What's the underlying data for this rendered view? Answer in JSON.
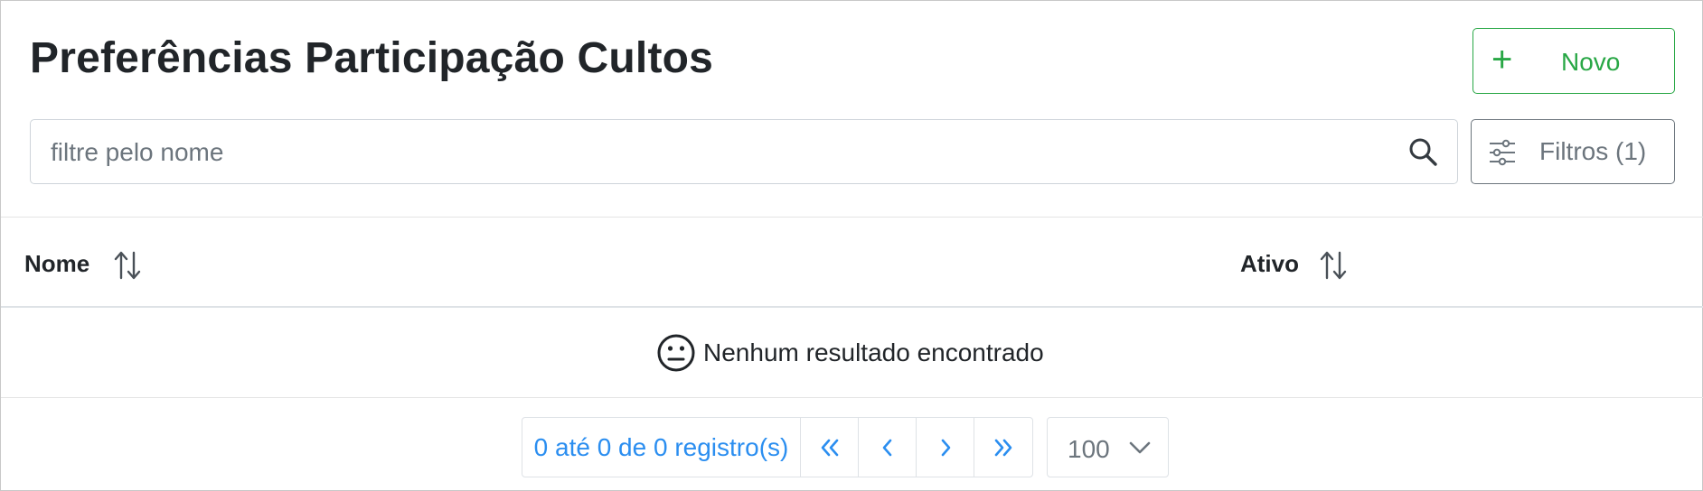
{
  "header": {
    "title": "Preferências Participação Cultos",
    "new_button": {
      "icon": "plus-icon",
      "label": "Novo"
    }
  },
  "search": {
    "placeholder": "filtre pelo nome",
    "value": "",
    "icon": "search-icon"
  },
  "filters_button": {
    "icon": "sliders-icon",
    "label": "Filtros (1)"
  },
  "table": {
    "columns": [
      {
        "label": "Nome",
        "sort_icon": "sort-up-down-icon"
      },
      {
        "label": "Ativo",
        "sort_icon": "sort-up-down-icon"
      }
    ],
    "rows": [],
    "empty_state": {
      "icon": "neutral-face-icon",
      "text": "Nenhum resultado encontrado"
    }
  },
  "pagination": {
    "info": "0 até 0 de 0 registro(s)",
    "buttons": [
      "first-page-icon",
      "prev-page-icon",
      "next-page-icon",
      "last-page-icon"
    ],
    "page_size": "100"
  },
  "colors": {
    "accent_green": "#28a745",
    "link_blue": "#2b8ef0",
    "muted_gray": "#6c757d",
    "text_dark": "#212529"
  }
}
